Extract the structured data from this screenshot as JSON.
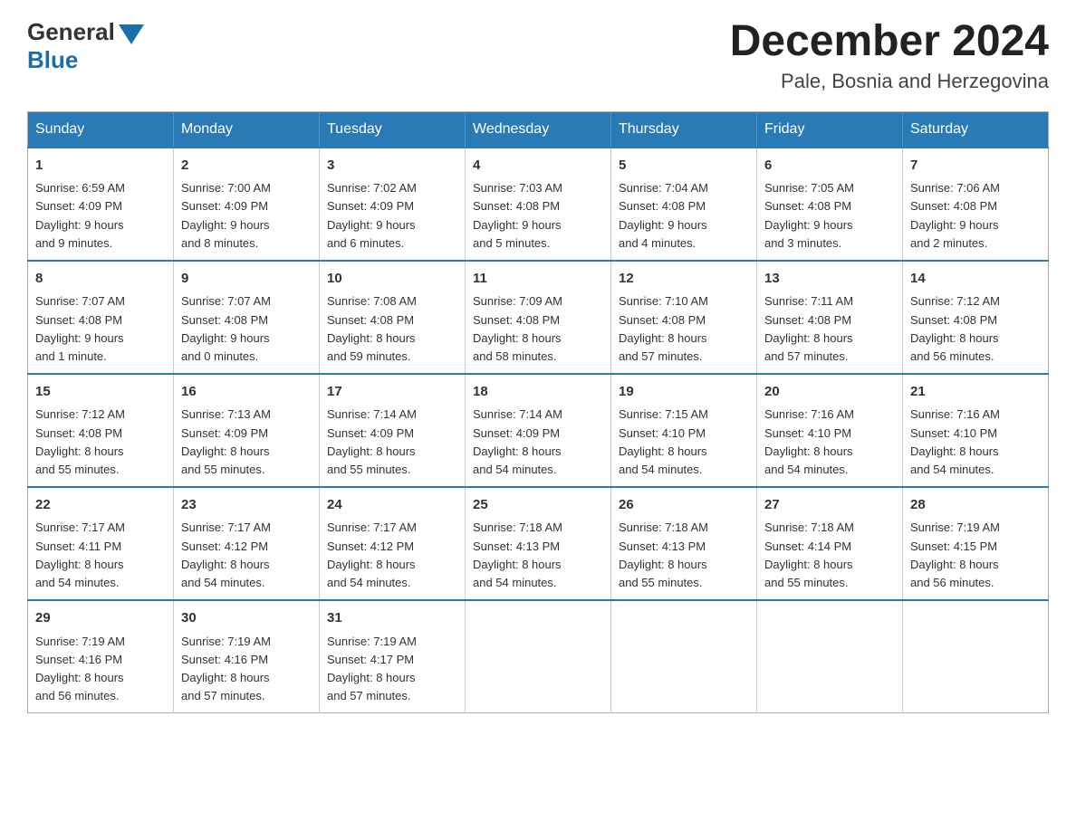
{
  "logo": {
    "general": "General",
    "blue": "Blue"
  },
  "title": {
    "month": "December 2024",
    "location": "Pale, Bosnia and Herzegovina"
  },
  "header_days": [
    "Sunday",
    "Monday",
    "Tuesday",
    "Wednesday",
    "Thursday",
    "Friday",
    "Saturday"
  ],
  "weeks": [
    [
      {
        "day": "1",
        "sunrise": "6:59 AM",
        "sunset": "4:09 PM",
        "daylight": "9 hours and 9 minutes."
      },
      {
        "day": "2",
        "sunrise": "7:00 AM",
        "sunset": "4:09 PM",
        "daylight": "9 hours and 8 minutes."
      },
      {
        "day": "3",
        "sunrise": "7:02 AM",
        "sunset": "4:09 PM",
        "daylight": "9 hours and 6 minutes."
      },
      {
        "day": "4",
        "sunrise": "7:03 AM",
        "sunset": "4:08 PM",
        "daylight": "9 hours and 5 minutes."
      },
      {
        "day": "5",
        "sunrise": "7:04 AM",
        "sunset": "4:08 PM",
        "daylight": "9 hours and 4 minutes."
      },
      {
        "day": "6",
        "sunrise": "7:05 AM",
        "sunset": "4:08 PM",
        "daylight": "9 hours and 3 minutes."
      },
      {
        "day": "7",
        "sunrise": "7:06 AM",
        "sunset": "4:08 PM",
        "daylight": "9 hours and 2 minutes."
      }
    ],
    [
      {
        "day": "8",
        "sunrise": "7:07 AM",
        "sunset": "4:08 PM",
        "daylight": "9 hours and 1 minute."
      },
      {
        "day": "9",
        "sunrise": "7:07 AM",
        "sunset": "4:08 PM",
        "daylight": "9 hours and 0 minutes."
      },
      {
        "day": "10",
        "sunrise": "7:08 AM",
        "sunset": "4:08 PM",
        "daylight": "8 hours and 59 minutes."
      },
      {
        "day": "11",
        "sunrise": "7:09 AM",
        "sunset": "4:08 PM",
        "daylight": "8 hours and 58 minutes."
      },
      {
        "day": "12",
        "sunrise": "7:10 AM",
        "sunset": "4:08 PM",
        "daylight": "8 hours and 57 minutes."
      },
      {
        "day": "13",
        "sunrise": "7:11 AM",
        "sunset": "4:08 PM",
        "daylight": "8 hours and 57 minutes."
      },
      {
        "day": "14",
        "sunrise": "7:12 AM",
        "sunset": "4:08 PM",
        "daylight": "8 hours and 56 minutes."
      }
    ],
    [
      {
        "day": "15",
        "sunrise": "7:12 AM",
        "sunset": "4:08 PM",
        "daylight": "8 hours and 55 minutes."
      },
      {
        "day": "16",
        "sunrise": "7:13 AM",
        "sunset": "4:09 PM",
        "daylight": "8 hours and 55 minutes."
      },
      {
        "day": "17",
        "sunrise": "7:14 AM",
        "sunset": "4:09 PM",
        "daylight": "8 hours and 55 minutes."
      },
      {
        "day": "18",
        "sunrise": "7:14 AM",
        "sunset": "4:09 PM",
        "daylight": "8 hours and 54 minutes."
      },
      {
        "day": "19",
        "sunrise": "7:15 AM",
        "sunset": "4:10 PM",
        "daylight": "8 hours and 54 minutes."
      },
      {
        "day": "20",
        "sunrise": "7:16 AM",
        "sunset": "4:10 PM",
        "daylight": "8 hours and 54 minutes."
      },
      {
        "day": "21",
        "sunrise": "7:16 AM",
        "sunset": "4:10 PM",
        "daylight": "8 hours and 54 minutes."
      }
    ],
    [
      {
        "day": "22",
        "sunrise": "7:17 AM",
        "sunset": "4:11 PM",
        "daylight": "8 hours and 54 minutes."
      },
      {
        "day": "23",
        "sunrise": "7:17 AM",
        "sunset": "4:12 PM",
        "daylight": "8 hours and 54 minutes."
      },
      {
        "day": "24",
        "sunrise": "7:17 AM",
        "sunset": "4:12 PM",
        "daylight": "8 hours and 54 minutes."
      },
      {
        "day": "25",
        "sunrise": "7:18 AM",
        "sunset": "4:13 PM",
        "daylight": "8 hours and 54 minutes."
      },
      {
        "day": "26",
        "sunrise": "7:18 AM",
        "sunset": "4:13 PM",
        "daylight": "8 hours and 55 minutes."
      },
      {
        "day": "27",
        "sunrise": "7:18 AM",
        "sunset": "4:14 PM",
        "daylight": "8 hours and 55 minutes."
      },
      {
        "day": "28",
        "sunrise": "7:19 AM",
        "sunset": "4:15 PM",
        "daylight": "8 hours and 56 minutes."
      }
    ],
    [
      {
        "day": "29",
        "sunrise": "7:19 AM",
        "sunset": "4:16 PM",
        "daylight": "8 hours and 56 minutes."
      },
      {
        "day": "30",
        "sunrise": "7:19 AM",
        "sunset": "4:16 PM",
        "daylight": "8 hours and 57 minutes."
      },
      {
        "day": "31",
        "sunrise": "7:19 AM",
        "sunset": "4:17 PM",
        "daylight": "8 hours and 57 minutes."
      },
      null,
      null,
      null,
      null
    ]
  ],
  "labels": {
    "sunrise": "Sunrise:",
    "sunset": "Sunset:",
    "daylight": "Daylight:"
  }
}
